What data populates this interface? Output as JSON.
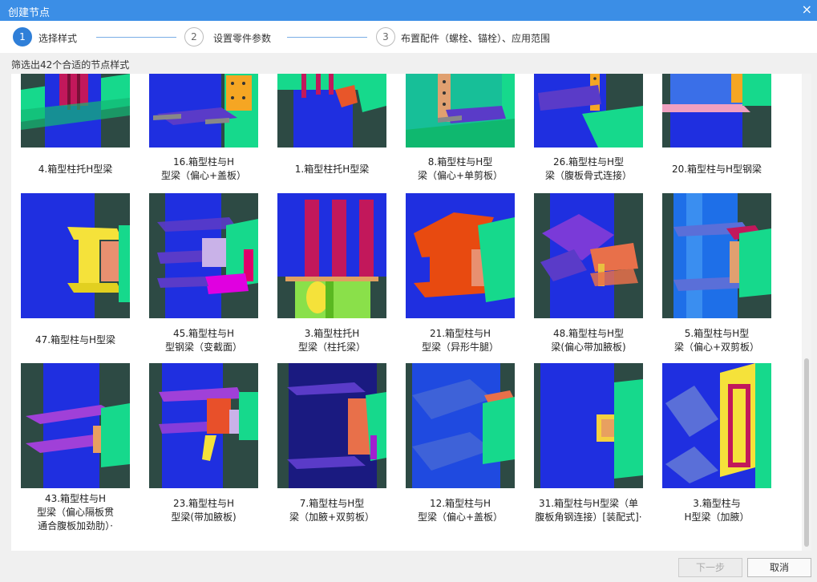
{
  "window": {
    "title": "创建节点",
    "close_glyph": "×"
  },
  "steps": [
    {
      "number": "1",
      "label": "选择样式"
    },
    {
      "number": "2",
      "label": "设置零件参数"
    },
    {
      "number": "3",
      "label": "布置配件（螺栓、锚栓）、应用范围"
    }
  ],
  "filter_text": "筛选出42个合适的节点样式",
  "rows": [
    [
      {
        "line1": "4.箱型柱托H型梁",
        "line2": "",
        "line3": ""
      },
      {
        "line1": "16.箱型柱与H",
        "line2": "型梁（偏心+盖板）",
        "line3": ""
      },
      {
        "line1": "1.箱型柱托H型梁",
        "line2": "",
        "line3": ""
      },
      {
        "line1": "8.箱型柱与H型",
        "line2": "梁（偏心+单剪板）",
        "line3": ""
      },
      {
        "line1": "26.箱型柱与H型",
        "line2": "梁（腹板骨式连接）",
        "line3": ""
      },
      {
        "line1": "20.箱型柱与H型钢梁",
        "line2": "",
        "line3": ""
      }
    ],
    [
      {
        "line1": "47.箱型柱与H型梁",
        "line2": "",
        "line3": ""
      },
      {
        "line1": "45.箱型柱与H",
        "line2": "型钢梁（变截面）",
        "line3": ""
      },
      {
        "line1": "3.箱型柱托H",
        "line2": "型梁（柱托梁）",
        "line3": ""
      },
      {
        "line1": "21.箱型柱与H",
        "line2": "型梁（异形牛腿）",
        "line3": ""
      },
      {
        "line1": "48.箱型柱与H型",
        "line2": "梁(偏心带加腋板)",
        "line3": ""
      },
      {
        "line1": "5.箱型柱与H型",
        "line2": "梁（偏心+双剪板）",
        "line3": ""
      }
    ],
    [
      {
        "line1": "43.箱型柱与H",
        "line2": "型梁（偏心隔板贯",
        "line3": "通合腹板加劲肋）·"
      },
      {
        "line1": "23.箱型柱与H",
        "line2": "型梁(带加腋板)",
        "line3": ""
      },
      {
        "line1": "7.箱型柱与H型",
        "line2": "梁（加腋+双剪板）",
        "line3": ""
      },
      {
        "line1": "12.箱型柱与H",
        "line2": "型梁（偏心+盖板）",
        "line3": ""
      },
      {
        "line1": "31.箱型柱与H型梁（单",
        "line2": "腹板角钢连接）[装配式]·",
        "line3": ""
      },
      {
        "line1": "3.箱型柱与",
        "line2": "H型梁（加腋）",
        "line3": ""
      }
    ]
  ],
  "buttons": {
    "next": "下一步",
    "cancel": "取消"
  },
  "colors": {
    "titlebar": "#3b8ee6",
    "step_active": "#2f7fd8",
    "column_blue": "#1f2fe0",
    "beam_green": "#17d98a"
  }
}
